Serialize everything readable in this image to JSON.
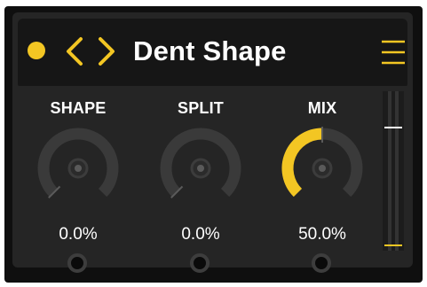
{
  "header": {
    "title": "Dent Shape"
  },
  "knobs": [
    {
      "label": "SHAPE",
      "value_text": "0.0%",
      "value": 0.0
    },
    {
      "label": "SPLIT",
      "value_text": "0.0%",
      "value": 0.0
    },
    {
      "label": "MIX",
      "value_text": "50.0%",
      "value": 0.5
    }
  ],
  "meter": {
    "level": 0.78,
    "peak": 0.04
  },
  "icons": {
    "power": "power-dot-icon",
    "prev": "chevron-left-icon",
    "next": "chevron-right-icon",
    "menu": "hamburger-menu-icon"
  },
  "colors": {
    "accent": "#f3c623",
    "knob_track": "#3a3a3a",
    "text": "#ffffff"
  }
}
